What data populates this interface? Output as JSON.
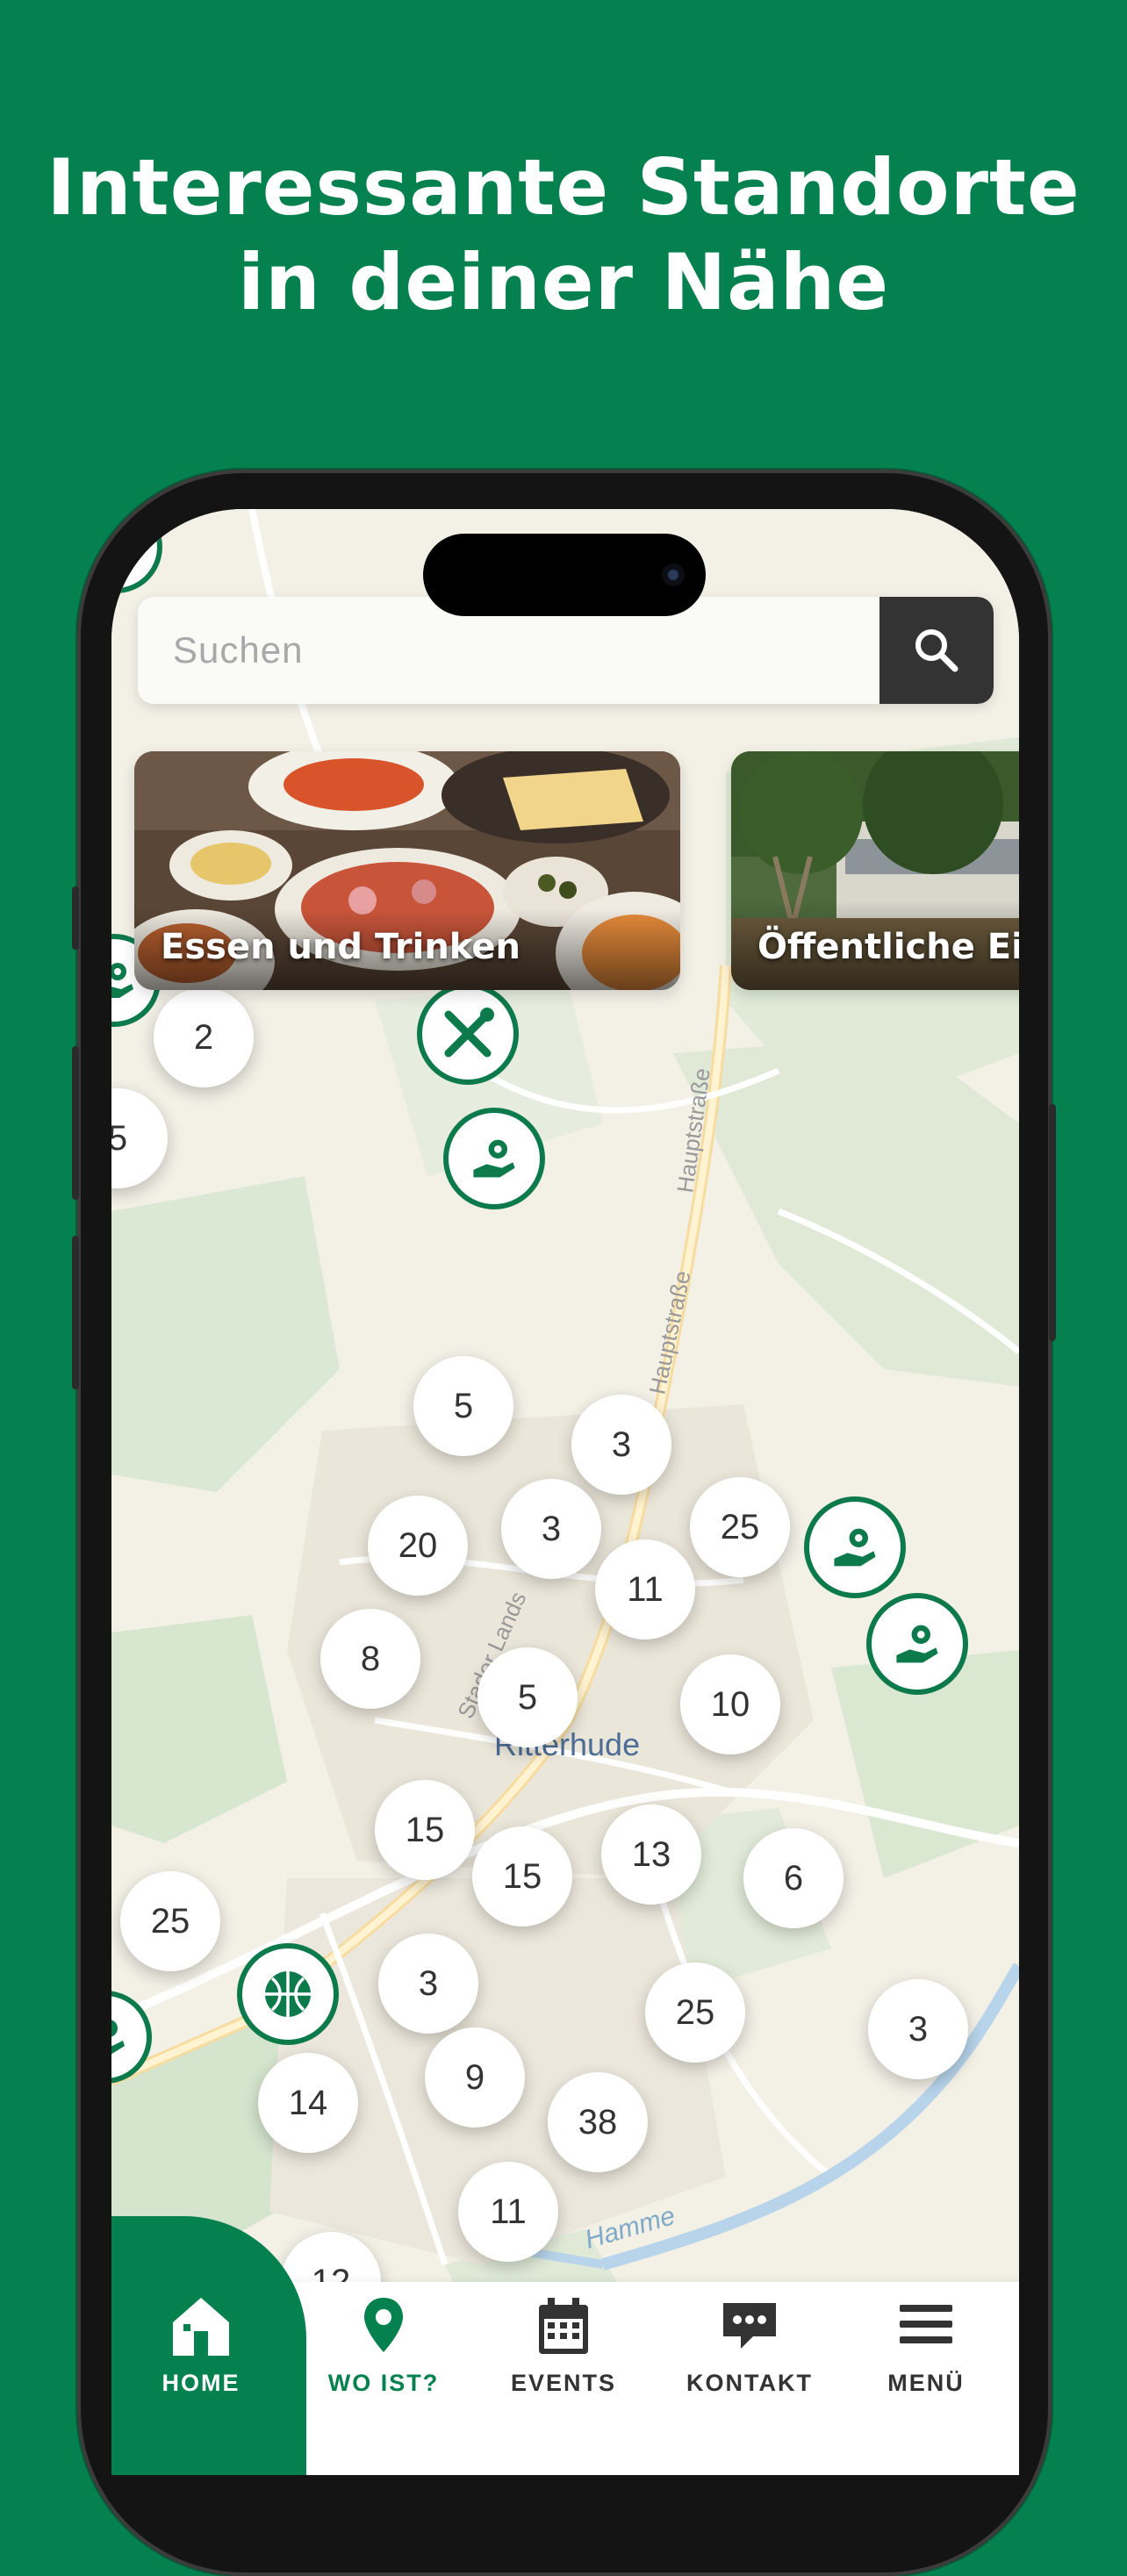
{
  "headline": {
    "line1": "Interessante Standorte",
    "line2": "in deiner Nähe"
  },
  "search": {
    "placeholder": "Suchen",
    "icon": "search-icon"
  },
  "categories": [
    {
      "label": "Essen und Trinken"
    },
    {
      "label": "Öffentliche Ei"
    }
  ],
  "map": {
    "town_label": "Ritterhude",
    "street_labels": [
      "Hauptstraße",
      "Hauptstraße",
      "Stader Lands",
      "Hamme"
    ],
    "clusters": [
      "2",
      "5",
      "5",
      "3",
      "20",
      "3",
      "25",
      "11",
      "8",
      "5",
      "10",
      "15",
      "15",
      "13",
      "6",
      "25",
      "3",
      "25",
      "3",
      "9",
      "14",
      "38",
      "11",
      "12"
    ],
    "poi_icons": [
      "gear-hand-icon",
      "tools-icon",
      "gear-hand-icon",
      "gear-hand-icon",
      "gear-hand-icon",
      "basketball-icon"
    ]
  },
  "nav": {
    "items": [
      {
        "label": "HOME",
        "icon": "home-icon",
        "active": true
      },
      {
        "label": "WO IST?",
        "icon": "location-pin-icon"
      },
      {
        "label": "EVENTS",
        "icon": "calendar-icon"
      },
      {
        "label": "KONTAKT",
        "icon": "chat-icon"
      },
      {
        "label": "MENÜ",
        "icon": "menu-icon"
      }
    ]
  },
  "colors": {
    "brand_green": "#05804f",
    "marker_green": "#0d7a4c",
    "dark": "#333333"
  }
}
